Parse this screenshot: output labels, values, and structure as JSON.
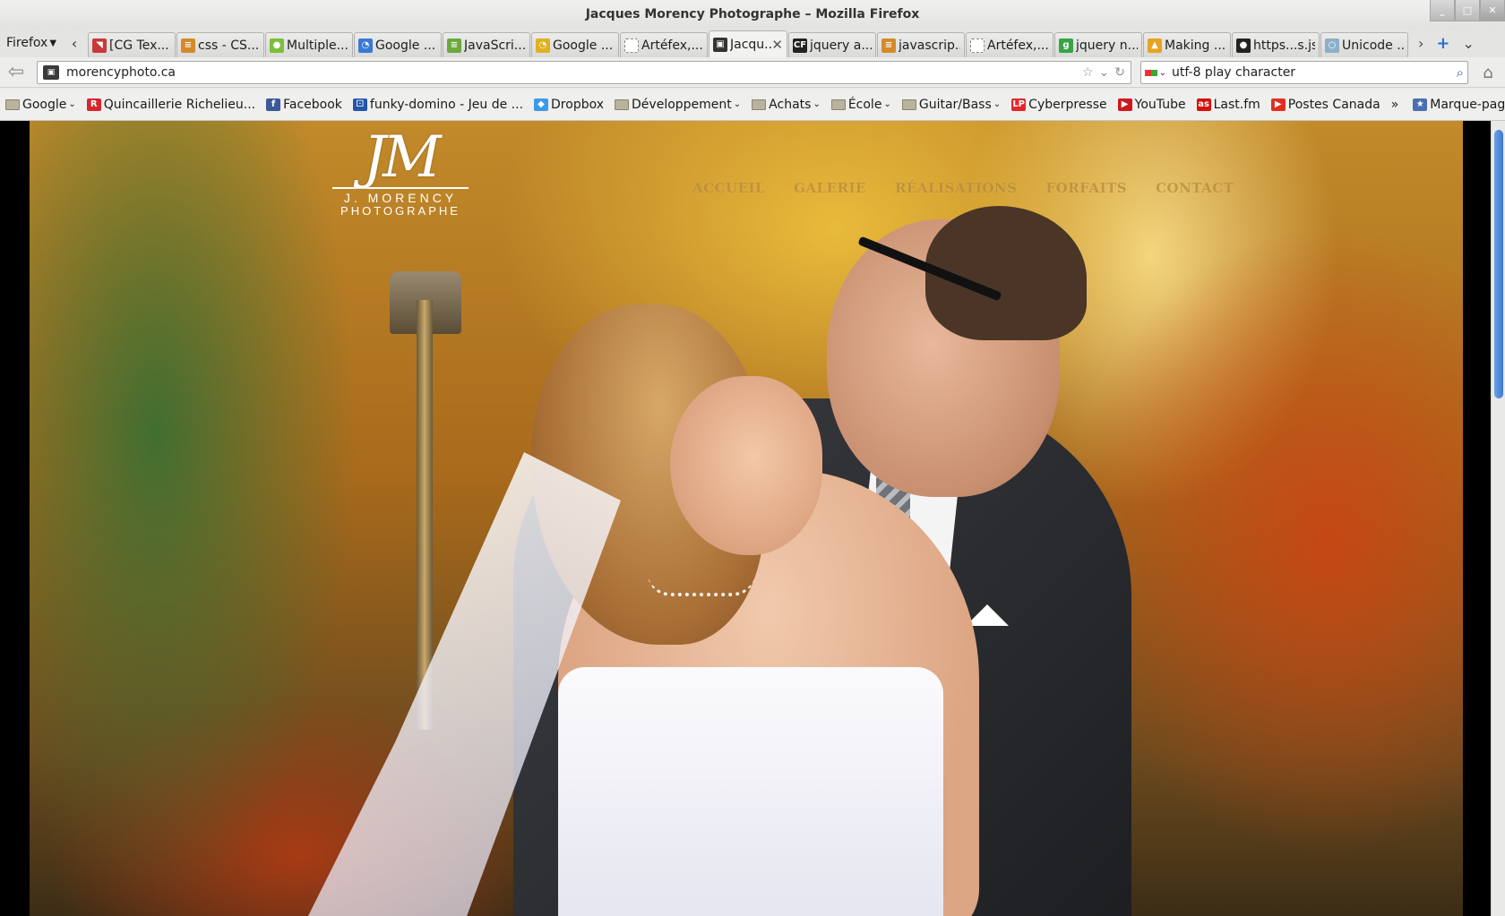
{
  "window": {
    "title": "Jacques Morency Photographe – Mozilla Firefox"
  },
  "browser": {
    "menu_label": "Firefox",
    "tabs": [
      {
        "label": "[CG Tex...",
        "fav_color": "#c83a3a",
        "fav_glyph": "◥"
      },
      {
        "label": "css - CS...",
        "fav_color": "#d58a2a",
        "fav_glyph": "≡"
      },
      {
        "label": "Multiple...",
        "fav_color": "#7bbf3a",
        "fav_glyph": "●"
      },
      {
        "label": "Google ...",
        "fav_color": "#3a7ad5",
        "fav_glyph": "◔"
      },
      {
        "label": "JavaScri...",
        "fav_color": "#6aa93a",
        "fav_glyph": "≡"
      },
      {
        "label": "Google ...",
        "fav_color": "#e0b020",
        "fav_glyph": "◔"
      },
      {
        "label": "Artéfex,...",
        "fav_color": "#ffffff",
        "fav_glyph": ""
      },
      {
        "label": "Jacqu...",
        "fav_color": "#333333",
        "fav_glyph": "▣",
        "selected": true
      },
      {
        "label": "jquery a...",
        "fav_color": "#222222",
        "fav_glyph": "CF"
      },
      {
        "label": "javascrip...",
        "fav_color": "#d58a2a",
        "fav_glyph": "≡"
      },
      {
        "label": "Artéfex,...",
        "fav_color": "#ffffff",
        "fav_glyph": ""
      },
      {
        "label": "jquery n...",
        "fav_color": "#3aa348",
        "fav_glyph": "g"
      },
      {
        "label": "Making ...",
        "fav_color": "#e7a420",
        "fav_glyph": "▲"
      },
      {
        "label": "https...s.js",
        "fav_color": "#222222",
        "fav_glyph": "●"
      },
      {
        "label": "Unicode ...",
        "fav_color": "#8bb0c8",
        "fav_glyph": "○"
      }
    ],
    "tab_close_glyph": "✕",
    "url": "morencyphoto.ca",
    "search_query": "utf-8 play character",
    "bookmarks": [
      {
        "label": "Google",
        "type": "folder",
        "dropdown": true
      },
      {
        "label": "Quincaillerie Richelieu...",
        "icon_color": "#d6262e",
        "glyph": "R"
      },
      {
        "label": "Facebook",
        "icon_color": "#3b5998",
        "glyph": "f"
      },
      {
        "label": "funky-domino - Jeu de ...",
        "icon_color": "#2356a8",
        "glyph": "⚀"
      },
      {
        "label": "Dropbox",
        "icon_color": "#3d9ae8",
        "glyph": "◆"
      },
      {
        "label": "Développement",
        "type": "folder",
        "dropdown": true
      },
      {
        "label": "Achats",
        "type": "folder",
        "dropdown": true
      },
      {
        "label": "École",
        "type": "folder",
        "dropdown": true
      },
      {
        "label": "Guitar/Bass",
        "type": "folder",
        "dropdown": true
      },
      {
        "label": "Cyberpresse",
        "icon_color": "#e3262b",
        "glyph": "LP"
      },
      {
        "label": "YouTube",
        "icon_color": "#cc181e",
        "glyph": "▶"
      },
      {
        "label": "Last.fm",
        "icon_color": "#d51007",
        "glyph": "as"
      },
      {
        "label": "Postes Canada",
        "icon_color": "#e32d1f",
        "glyph": "▶"
      }
    ],
    "bookmarks_menu_label": "Marque-pages"
  },
  "site": {
    "logo": {
      "monogram": "JM",
      "name": "J. MORENCY",
      "subtitle": "PHOTOGRAPHE"
    },
    "nav": [
      "ACCUEIL",
      "GALERIE",
      "RÉALISATIONS",
      "FORFAITS",
      "CONTACT"
    ]
  }
}
